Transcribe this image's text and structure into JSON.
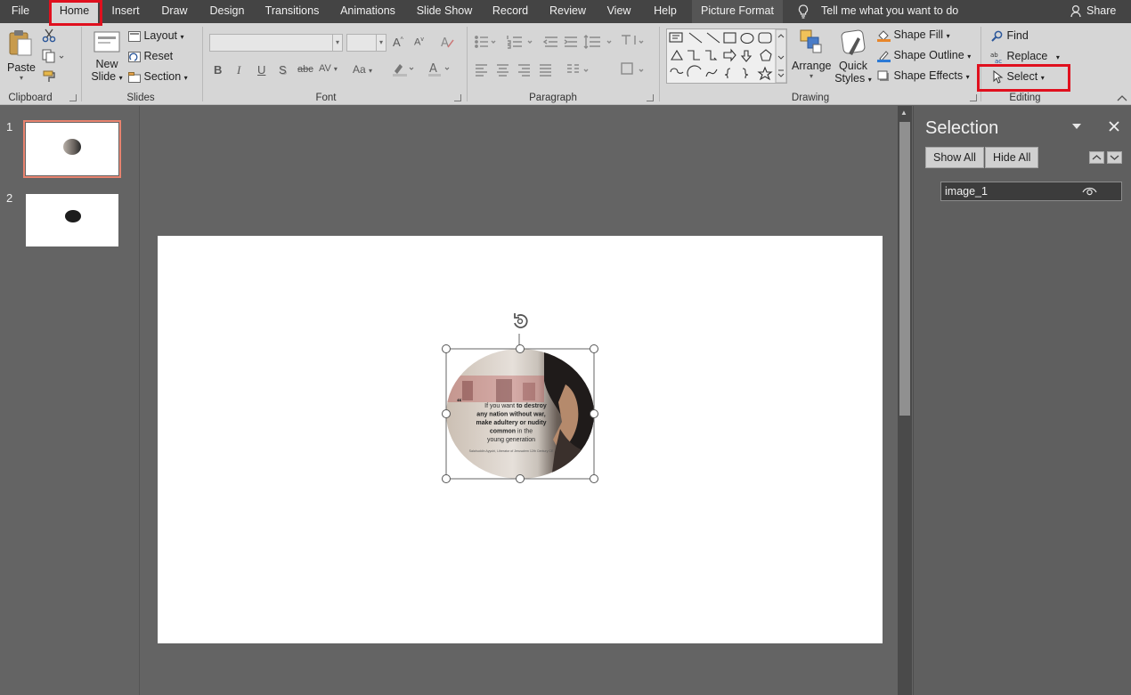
{
  "tabs": {
    "file": "File",
    "home": "Home",
    "insert": "Insert",
    "draw": "Draw",
    "design": "Design",
    "transitions": "Transitions",
    "animations": "Animations",
    "slideshow": "Slide Show",
    "record": "Record",
    "review": "Review",
    "view": "View",
    "help": "Help",
    "picture_format": "Picture Format"
  },
  "tellme": "Tell me what you want to do",
  "share": "Share",
  "clipboard": {
    "paste": "Paste",
    "label": "Clipboard"
  },
  "slides": {
    "new_slide_line1": "New",
    "new_slide_line2": "Slide",
    "layout": "Layout",
    "reset": "Reset",
    "section": "Section",
    "label": "Slides"
  },
  "font": {
    "label": "Font",
    "bold": "B",
    "italic": "I",
    "underline": "U",
    "shadow": "S",
    "strike": "abc",
    "spacing": "AV",
    "case": "Aa"
  },
  "paragraph": {
    "label": "Paragraph"
  },
  "drawing": {
    "arrange": "Arrange",
    "quick_styles_line1": "Quick",
    "quick_styles_line2": "Styles",
    "shape_fill": "Shape Fill",
    "shape_outline": "Shape Outline",
    "shape_effects": "Shape Effects",
    "label": "Drawing"
  },
  "editing": {
    "find": "Find",
    "replace": "Replace",
    "select": "Select",
    "label": "Editing"
  },
  "thumbnails": [
    "1",
    "2"
  ],
  "selection_pane": {
    "title": "Selection",
    "show_all": "Show All",
    "hide_all": "Hide All",
    "items": [
      "image_1"
    ]
  },
  "slide_image": {
    "quote_line1a": "If you want ",
    "quote_line1b": "to destroy",
    "quote_line2": "any nation without war,",
    "quote_line3": "make adultery or nudity",
    "quote_line4a": "common",
    "quote_line4b": " in the",
    "quote_line5": "young generation",
    "attribution": "Salahuddin Ayyubi, Liberator of Jerusalem 12th Century CE"
  },
  "colors": {
    "accent_red": "#e0101e",
    "ribbon": "#d6d6d6",
    "background": "#646464"
  }
}
